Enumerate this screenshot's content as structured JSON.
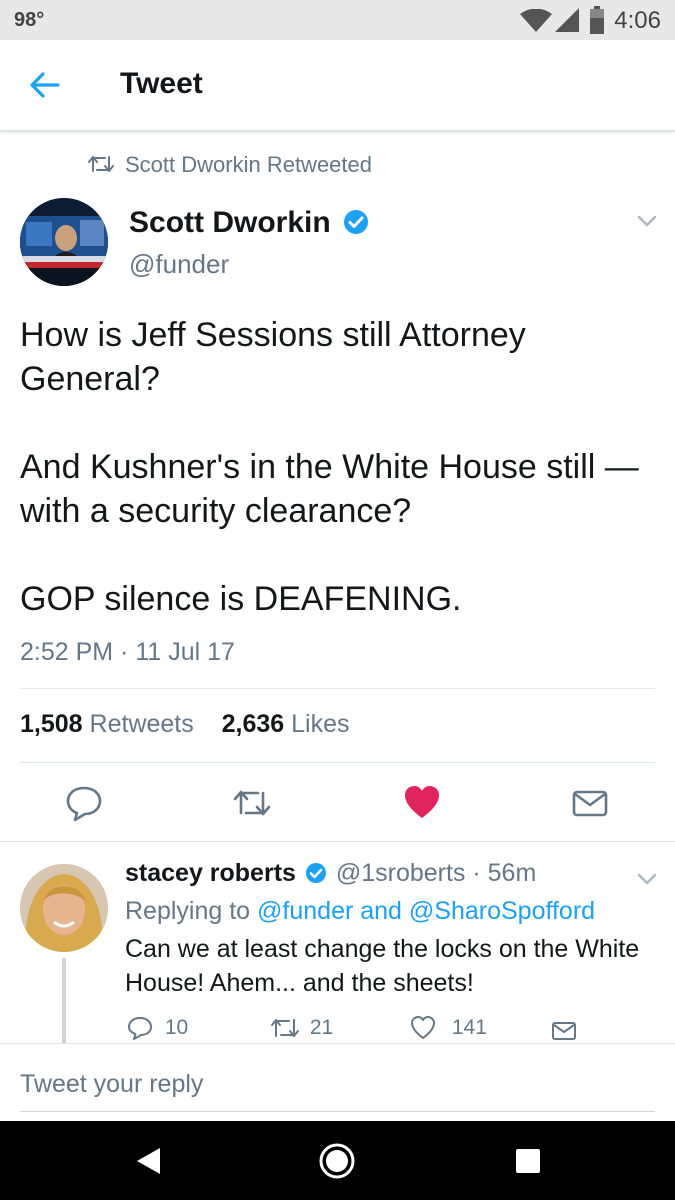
{
  "status_bar": {
    "temperature": "98°",
    "time": "4:06"
  },
  "app_bar": {
    "title": "Tweet",
    "back_icon": "arrow-left-icon"
  },
  "retweet_context": {
    "label": "Scott Dworkin Retweeted"
  },
  "tweet": {
    "author_name": "Scott Dworkin",
    "author_handle": "@funder",
    "verified": true,
    "paragraphs": [
      "How is Jeff Sessions still Attorney General?",
      "And Kushner's in the White House still —with a security clearance?",
      "GOP silence is DEAFENING."
    ],
    "timestamp": "2:52 PM · 11 Jul 17",
    "retweets_count": "1,508",
    "retweets_label": "Retweets",
    "likes_count": "2,636",
    "likes_label": "Likes",
    "liked": true
  },
  "reply": {
    "author_name": "stacey roberts",
    "meta": "@1sroberts · 56m",
    "replying_prefix": "Replying to",
    "replying_targets": "@funder and @SharoSpofford",
    "text": "Can we at least change the locks on the White House! Ahem... and the sheets!",
    "reply_count": "10",
    "retweet_count": "21",
    "like_count": "141"
  },
  "compose": {
    "placeholder": "Tweet your reply"
  },
  "colors": {
    "accent": "#1da1f2",
    "like": "#e0245e",
    "secondary_text": "#657786"
  }
}
